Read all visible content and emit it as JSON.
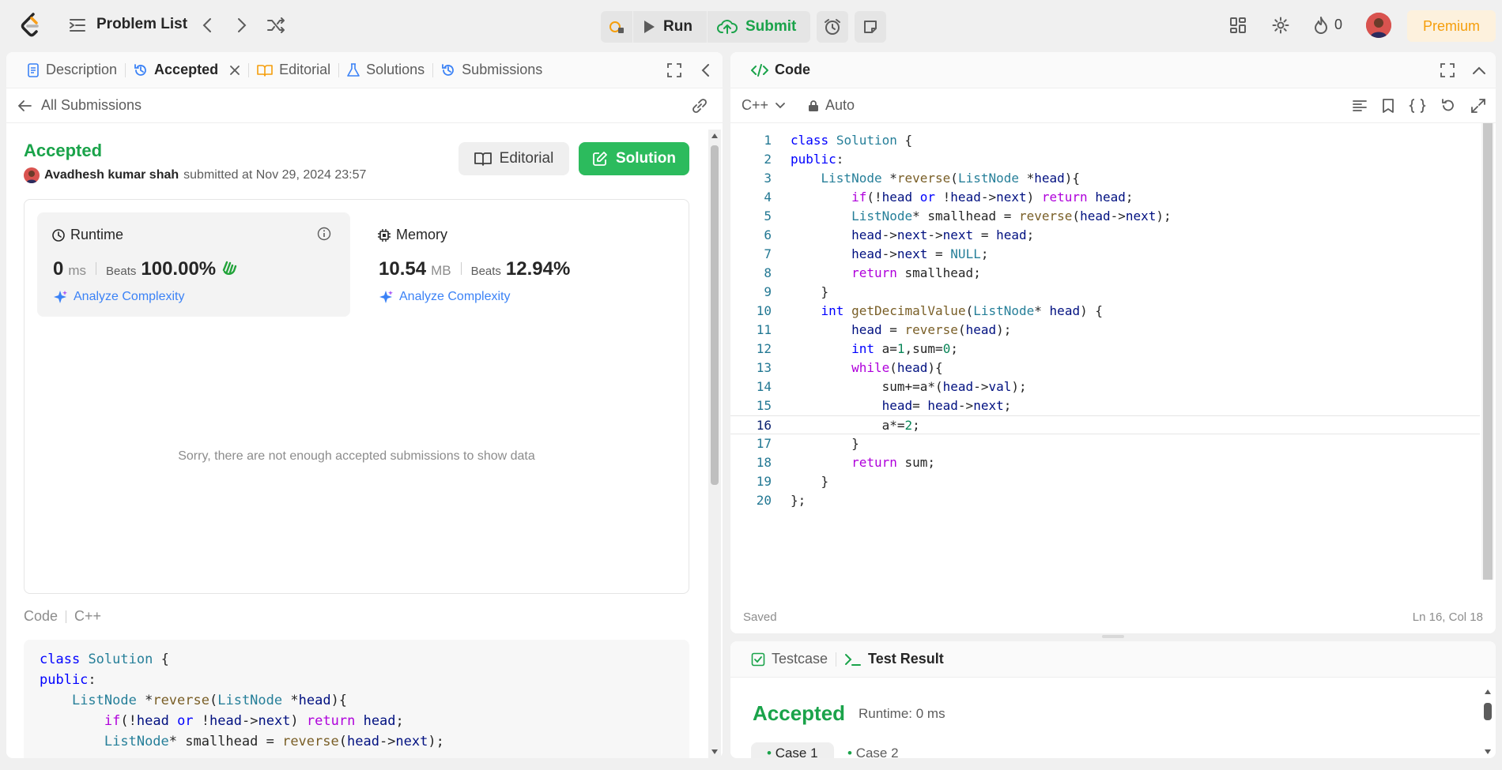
{
  "topbar": {
    "problem_list_label": "Problem List",
    "run_label": "Run",
    "submit_label": "Submit",
    "streak_count": "0",
    "premium_label": "Premium"
  },
  "left_tabs": [
    {
      "label": "Description",
      "icon": "description-icon"
    },
    {
      "label": "Accepted",
      "icon": "history-icon"
    },
    {
      "label": "Editorial",
      "icon": "book-icon"
    },
    {
      "label": "Solutions",
      "icon": "flask-icon"
    },
    {
      "label": "Submissions",
      "icon": "history-icon"
    }
  ],
  "submission": {
    "back_label": "All Submissions",
    "status": "Accepted",
    "user": "Avadhesh kumar shah",
    "submitted_text": "submitted at Nov 29, 2024 23:57",
    "editorial_button": "Editorial",
    "solution_button": "Solution",
    "runtime": {
      "title": "Runtime",
      "value": "0",
      "unit": "ms",
      "beats_label": "Beats",
      "beats_pct": "100.00%",
      "analyze": "Analyze Complexity"
    },
    "memory": {
      "title": "Memory",
      "value": "10.54",
      "unit": "MB",
      "beats_label": "Beats",
      "beats_pct": "12.94%",
      "analyze": "Analyze Complexity"
    },
    "empty_message": "Sorry, there are not enough accepted submissions to show data",
    "code_label": "Code",
    "code_lang": "C++",
    "code_preview": "class Solution {\npublic:\n    ListNode *reverse(ListNode *head){\n        if(!head or !head->next) return head;\n        ListNode* smallhead = reverse(head->next);"
  },
  "editor": {
    "title": "Code",
    "language": "C++",
    "mode": "Auto",
    "status": "Saved",
    "cursor": "Ln 16, Col 18",
    "current_line": 16,
    "lines": [
      "class Solution {",
      "public:",
      "    ListNode *reverse(ListNode *head){",
      "        if(!head or !head->next) return head;",
      "        ListNode* smallhead = reverse(head->next);",
      "        head->next->next = head;",
      "        head->next = NULL;",
      "        return smallhead;",
      "    }",
      "    int getDecimalValue(ListNode* head) {",
      "        head = reverse(head);",
      "        int a=1,sum=0;",
      "        while(head){",
      "            sum+=a*(head->val);",
      "            head= head->next;",
      "            a*=2;",
      "        }",
      "        return sum;",
      "    }",
      "};"
    ]
  },
  "test_panel": {
    "testcase_tab": "Testcase",
    "result_tab": "Test Result",
    "status": "Accepted",
    "runtime": "Runtime: 0 ms",
    "cases": [
      "Case 1",
      "Case 2"
    ]
  },
  "colors": {
    "accepted_green": "#1aa34a",
    "solution_button": "#2cbb5d",
    "premium": "#f59e0b",
    "analyze_blue": "#3b82f6"
  }
}
